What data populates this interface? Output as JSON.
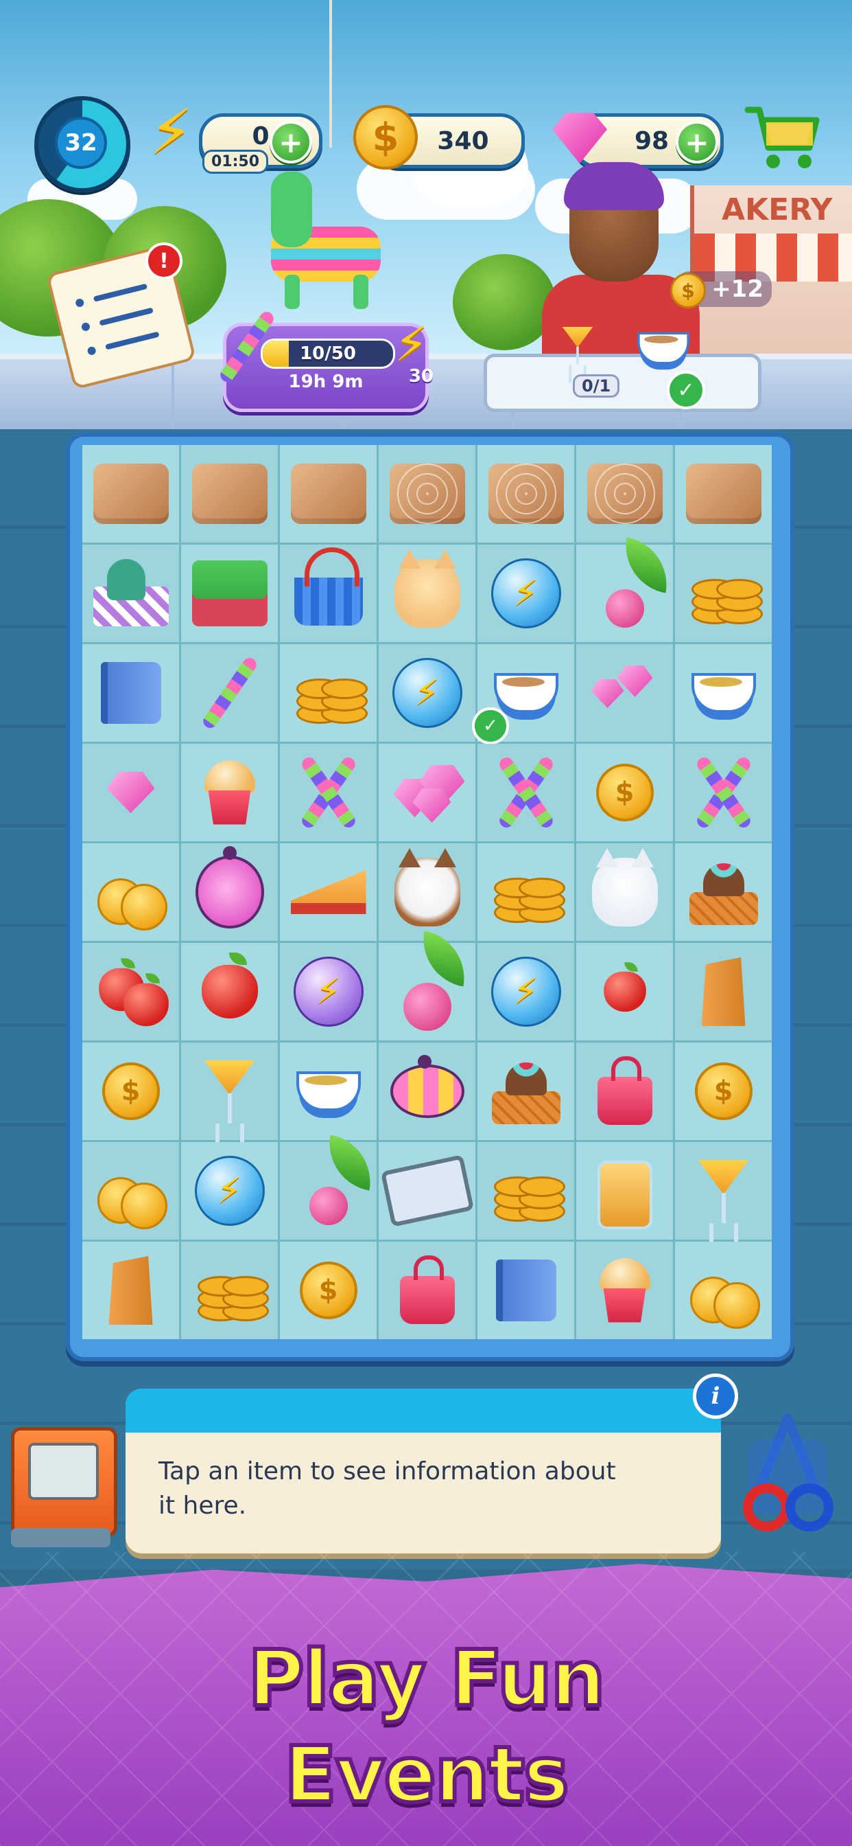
{
  "hud": {
    "level": "32",
    "level_progress": 0.6,
    "energy": "0",
    "energy_timer": "01:50",
    "coins": "340",
    "gems": "98",
    "plus_label": "+"
  },
  "event": {
    "progress_label": "10/50",
    "progress": 0.2,
    "timer": "19h 9m",
    "reward_count": "30"
  },
  "order": {
    "count": "0/1",
    "bonus": "+12",
    "shop_sign": "AKERY"
  },
  "notepad": {
    "alert": "!"
  },
  "board": {
    "rows": [
      [
        "box",
        "web-herb",
        "web-pie",
        "web-bag",
        "box",
        "box",
        "box"
      ],
      [
        "picnic",
        "stove",
        "basket",
        "cat-orange",
        "orb-blue",
        "radish",
        "coin-stack"
      ],
      [
        "book",
        "bat",
        "coin-stack",
        "orb-blue",
        "latte-check",
        "gems",
        "tea-cup"
      ],
      [
        "gem",
        "muffin",
        "bats",
        "gems-big",
        "bats",
        "coin",
        "bats"
      ],
      [
        "coins",
        "ladybug",
        "pie",
        "cat-calico",
        "coin-stack",
        "cat-white",
        "waffle"
      ],
      [
        "apples",
        "apple",
        "orb-purple",
        "radish-big",
        "orb-blue",
        "apple-small",
        "paper-bag"
      ],
      [
        "coin",
        "cocktail",
        "tea-cup",
        "beetle",
        "waffle",
        "handbag",
        "coin"
      ],
      [
        "coins",
        "orb-blue",
        "radish",
        "tray",
        "coin-stack",
        "jar",
        "cocktail"
      ],
      [
        "paper-bag",
        "coin-stack",
        "coin",
        "purse",
        "book",
        "muffin",
        "coins"
      ]
    ],
    "row0_override": [
      "box",
      "box",
      "box",
      "web-herb",
      "web-pie",
      "web-bag",
      "box"
    ]
  },
  "info_panel": {
    "text": "Tap an item to see information about it here.",
    "info_button": "i"
  },
  "promo": {
    "line1": "Play Fun",
    "line2": "Events"
  },
  "colors": {
    "accent_blue": "#1db6e8",
    "board_blue": "#4a9be0",
    "promo_purple": "#9a3fbf",
    "promo_yellow": "#fff447"
  }
}
